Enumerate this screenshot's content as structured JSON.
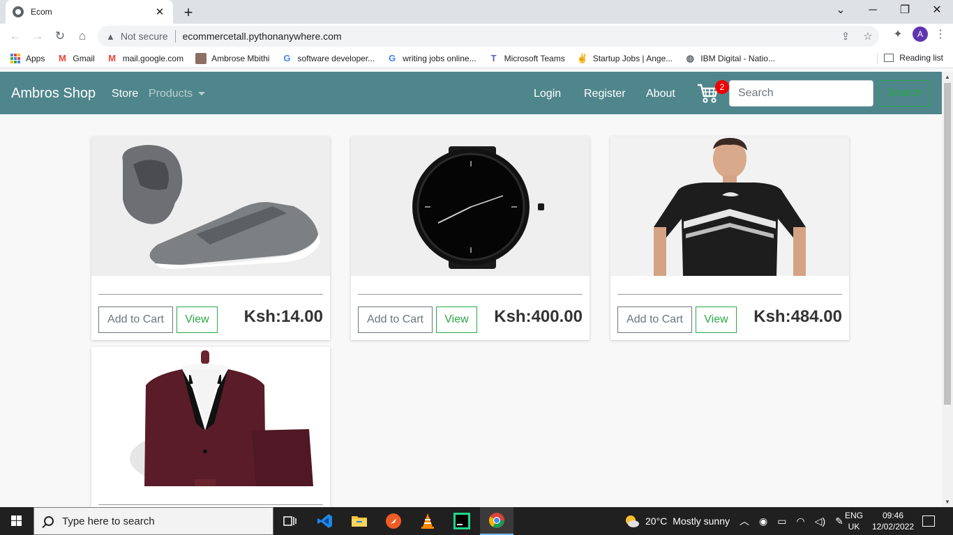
{
  "browser": {
    "tab_title": "Ecom",
    "url_warning": "Not secure",
    "url": "ecommercetall.pythonanywhere.com",
    "profile_initial": "A",
    "bookmarks": [
      {
        "label": "Apps",
        "icon": "apps-grid-icon"
      },
      {
        "label": "Gmail",
        "icon": "gmail-icon"
      },
      {
        "label": "mail.google.com",
        "icon": "gmail-icon"
      },
      {
        "label": "Ambrose Mbithi",
        "icon": "profile-photo-icon"
      },
      {
        "label": "software developer...",
        "icon": "google-icon"
      },
      {
        "label": "writing jobs online...",
        "icon": "google-icon"
      },
      {
        "label": "Microsoft Teams",
        "icon": "teams-icon"
      },
      {
        "label": "Startup Jobs | Ange...",
        "icon": "angellist-icon"
      },
      {
        "label": "IBM Digital - Natio...",
        "icon": "globe-icon"
      }
    ],
    "reading_list": "Reading list"
  },
  "navbar": {
    "brand": "Ambros Shop",
    "store": "Store",
    "products": "Products",
    "login": "Login",
    "register": "Register",
    "about": "About",
    "cart_count": "2",
    "search_placeholder": "Search",
    "search_button": "Search",
    "color": "#4f868c"
  },
  "products": [
    {
      "image": "grey-sneakers",
      "add_label": "Add to Cart",
      "view_label": "View",
      "price": "Ksh:14.00"
    },
    {
      "image": "black-watch",
      "add_label": "Add to Cart",
      "view_label": "View",
      "price": "Ksh:400.00"
    },
    {
      "image": "black-puma-tshirt",
      "add_label": "Add to Cart",
      "view_label": "View",
      "price": "Ksh:484.00"
    },
    {
      "image": "maroon-tuxedo-suit"
    }
  ],
  "taskbar": {
    "search_placeholder": "Type here to search",
    "weather_temp": "20°C",
    "weather_text": "Mostly sunny",
    "lang_top": "ENG",
    "lang_bottom": "UK",
    "time": "09:46",
    "date": "12/02/2022"
  }
}
